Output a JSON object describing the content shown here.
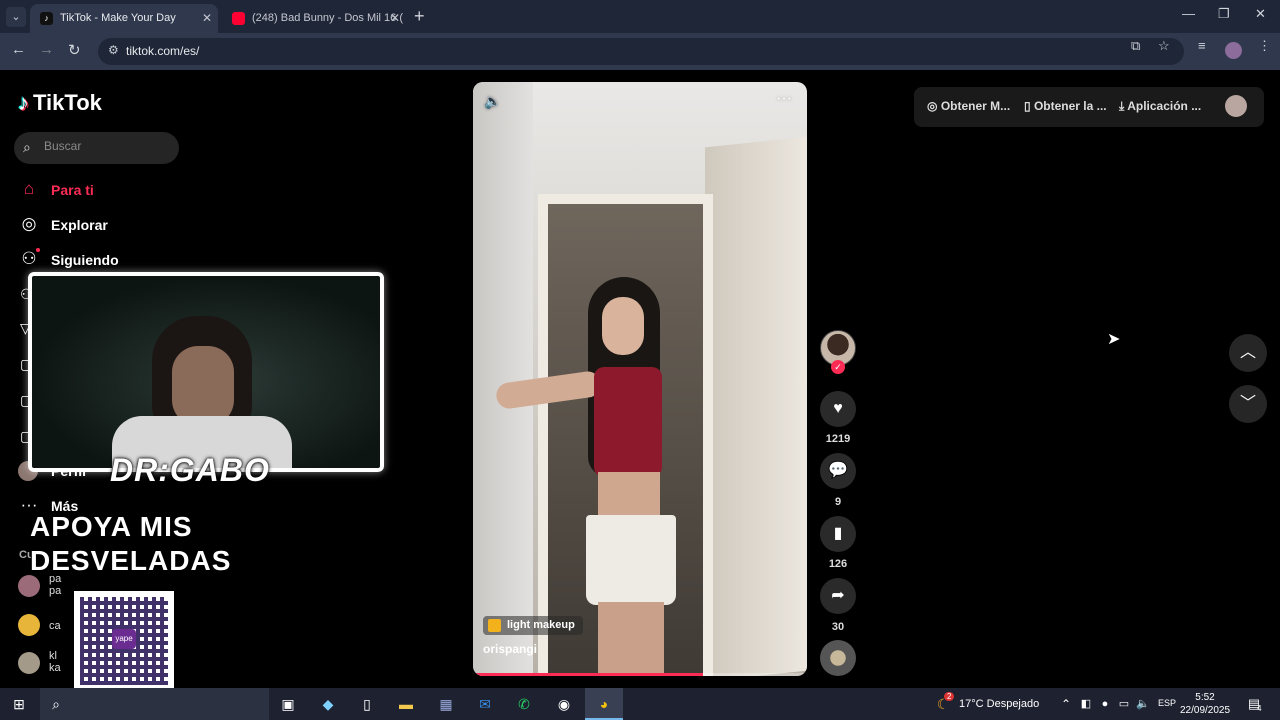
{
  "browser": {
    "tabs": [
      {
        "title": "TikTok - Make Your Day",
        "active": true
      },
      {
        "title": "(248) Bad Bunny - Dos Mil 16 (",
        "active": false
      }
    ],
    "url": "tiktok.com/es/"
  },
  "sidebar": {
    "logo": "TikTok",
    "search_placeholder": "Buscar",
    "items": [
      {
        "label": "Para ti",
        "icon": "home-icon",
        "active": true
      },
      {
        "label": "Explorar",
        "icon": "compass-icon",
        "active": false
      },
      {
        "label": "Siguiendo",
        "icon": "following-icon",
        "active": false
      },
      {
        "label": "Perfil",
        "icon": "profile-icon",
        "active": false
      },
      {
        "label": "Más",
        "icon": "more-icon",
        "active": false
      }
    ],
    "following_section": "Cu",
    "following": [
      {
        "name": "pa\npa"
      },
      {
        "name": "ca"
      },
      {
        "name": "kl\nka"
      }
    ]
  },
  "video": {
    "effect_label": "light makeup",
    "author": "orispangi",
    "progress": 0.69
  },
  "actions": {
    "likes": "1219",
    "comments": "9",
    "saves": "126",
    "shares": "30"
  },
  "topbar": {
    "item1": "Obtener M...",
    "item2": "Obtener la ...",
    "item3": "Aplicación ..."
  },
  "overlay": {
    "cam_tag": "DR:GABO",
    "promo_line1": "APOYA MIS",
    "promo_line2": "DESVELADAS",
    "qr_label": "yape"
  },
  "taskbar": {
    "weather": "17°C  Despejado",
    "weather_badge": "2",
    "lang": "ESP",
    "time": "5:52",
    "date": "22/09/2025",
    "notifications": "4"
  }
}
